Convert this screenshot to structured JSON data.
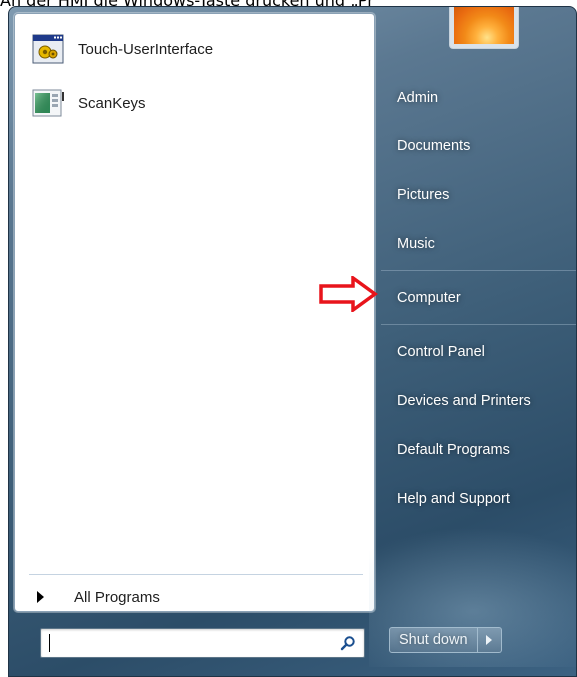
{
  "caption": "An der HMI die Windows-Taste drücken und „Pr",
  "programs": [
    {
      "label": "Touch-UserInterface",
      "icon": "touch-userinterface-icon"
    },
    {
      "label": "ScanKeys",
      "icon": "scankeys-icon"
    }
  ],
  "all_programs": {
    "label": "All Programs"
  },
  "search": {
    "value": "",
    "placeholder": ""
  },
  "right_menu": {
    "admin": "Admin",
    "documents": "Documents",
    "pictures": "Pictures",
    "music": "Music",
    "computer": "Computer",
    "control_panel": "Control Panel",
    "devices_printers": "Devices and Printers",
    "default_programs": "Default Programs",
    "help_support": "Help and Support"
  },
  "shutdown": {
    "label": "Shut down"
  },
  "colors": {
    "annotation_arrow": "#e8141b",
    "pane_bg": "#ffffff"
  }
}
